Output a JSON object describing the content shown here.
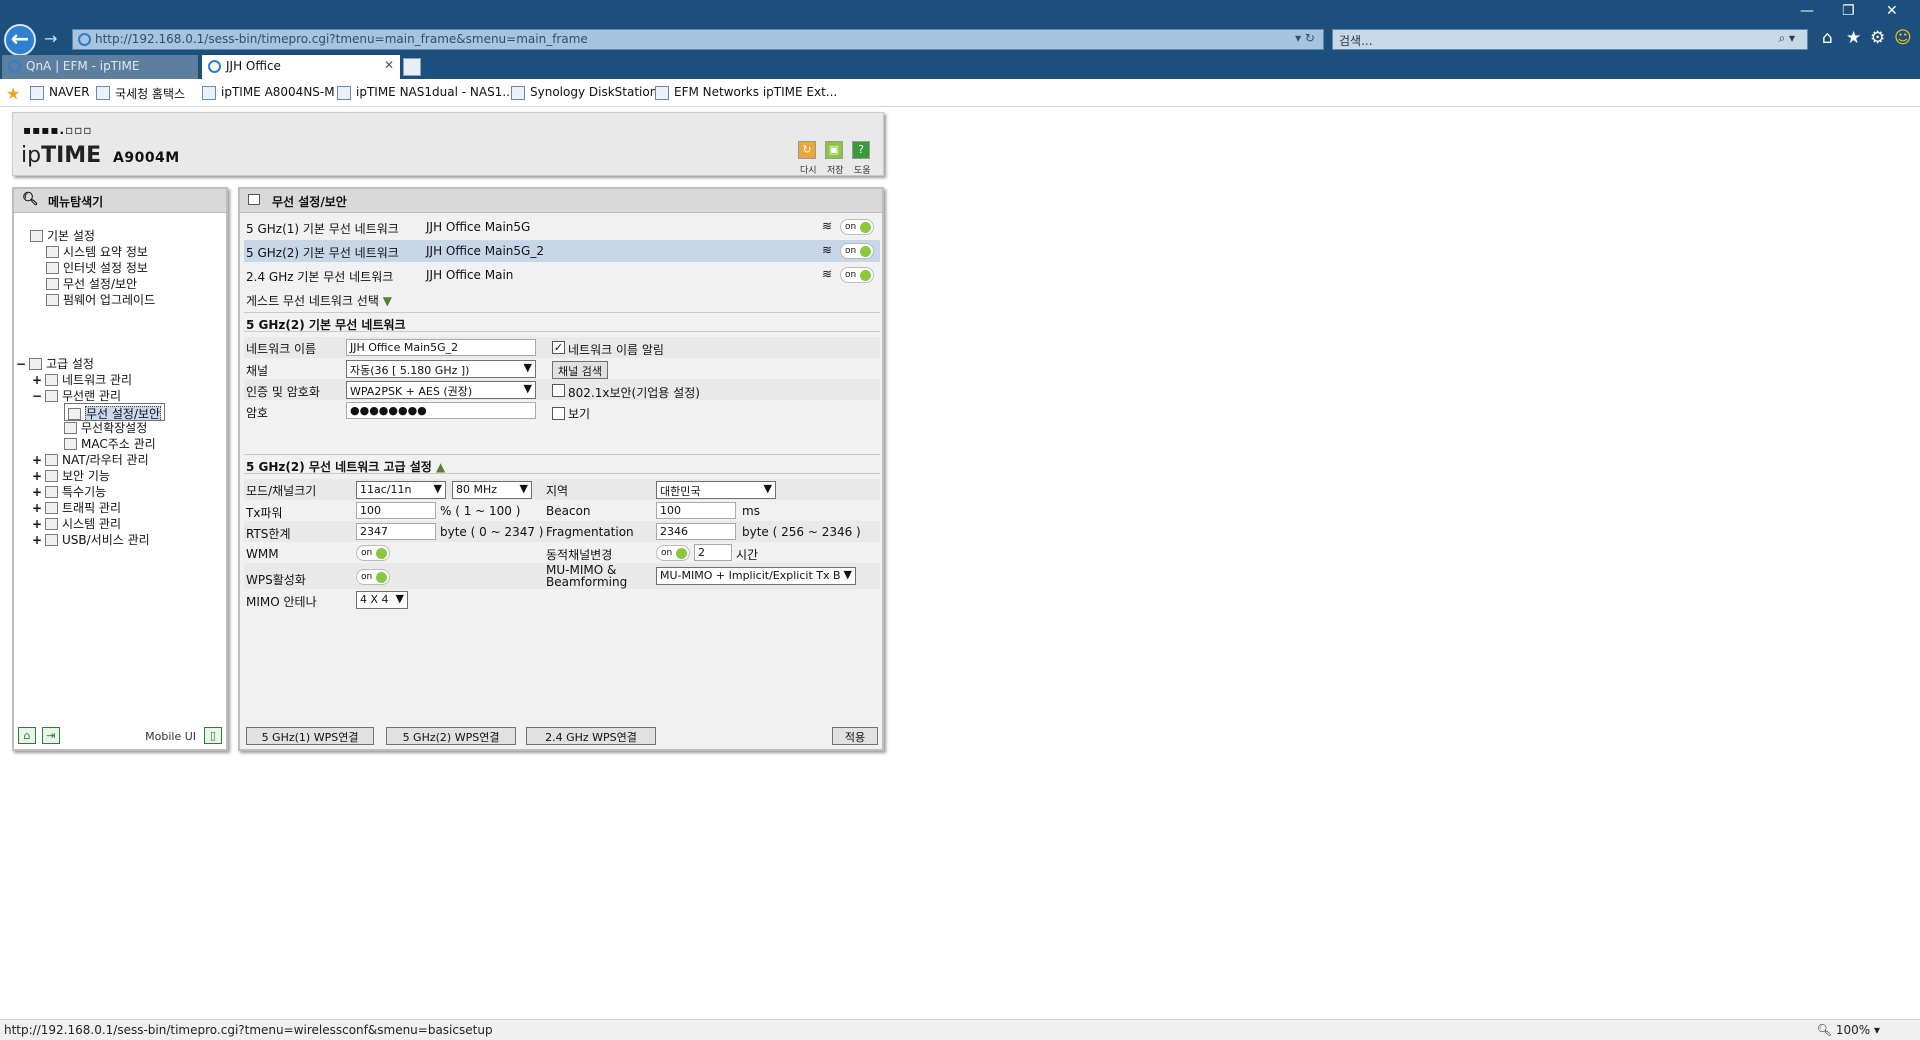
{
  "browser": {
    "url": "http://192.168.0.1/sess-bin/timepro.cgi?tmenu=main_frame&smenu=main_frame",
    "search_placeholder": "검색...",
    "tabs": [
      {
        "label": "QnA | EFM - ipTIME"
      },
      {
        "label": "JJH Office"
      }
    ],
    "favorites": [
      {
        "label": "NAVER"
      },
      {
        "label": "국세청 홈택스"
      },
      {
        "label": "ipTIME A8004NS-M"
      },
      {
        "label": "ipTIME NAS1dual - NAS1..."
      },
      {
        "label": "Synology DiskStation"
      },
      {
        "label": "EFM Networks ipTIME Ext..."
      }
    ],
    "status_url": "http://192.168.0.1/sess-bin/timepro.cgi?tmenu=wirelessconf&smenu=basicsetup",
    "zoom": "100%"
  },
  "router": {
    "brand_prefix": "ip",
    "brand_bold": "TIME",
    "model": "A9004M",
    "header_buttons": [
      {
        "label": "다시"
      },
      {
        "label": "저장"
      },
      {
        "label": "도움"
      }
    ]
  },
  "sidebar": {
    "title": "메뉴탐색기",
    "basic": {
      "label": "기본 설정",
      "items": [
        "시스템 요약 정보",
        "인터넷 설정 정보",
        "무선 설정/보안",
        "펌웨어 업그레이드"
      ]
    },
    "advanced": {
      "label": "고급 설정",
      "items": [
        {
          "label": "네트워크 관리",
          "pm": "+"
        },
        {
          "label": "무선랜 관리",
          "pm": "−"
        },
        {
          "label": "NAT/라우터 관리",
          "pm": "+"
        },
        {
          "label": "보안 기능",
          "pm": "+"
        },
        {
          "label": "특수기능",
          "pm": "+"
        },
        {
          "label": "트래픽 관리",
          "pm": "+"
        },
        {
          "label": "시스템 관리",
          "pm": "+"
        },
        {
          "label": "USB/서비스 관리",
          "pm": "+"
        }
      ],
      "wireless_sub": [
        "무선 설정/보안",
        "무선확장설정",
        "MAC주소 관리"
      ]
    },
    "mobile_ui": "Mobile UI"
  },
  "main": {
    "title": "무선 설정/보안",
    "networks": [
      {
        "name": "5 GHz(1) 기본 무선 네트워크",
        "ssid": "JJH Office Main5G",
        "state": "on"
      },
      {
        "name": "5 GHz(2) 기본 무선 네트워크",
        "ssid": "JJH Office Main5G_2",
        "state": "on"
      },
      {
        "name": "2.4 GHz 기본 무선 네트워크",
        "ssid": "JJH Office Main",
        "state": "on"
      }
    ],
    "guest_label": "게스트 무선 네트워크 선택",
    "basic_section": {
      "title": "5 GHz(2) 기본 무선 네트워크",
      "network_name_label": "네트워크 이름",
      "network_name_value": "JJH Office Main5G_2",
      "broadcast_label": "네트워크 이름 알림",
      "channel_label": "채널",
      "channel_value": "자동(36 [ 5.180 GHz ])",
      "channel_search": "채널 검색",
      "auth_label": "인증 및 암호화",
      "auth_value": "WPA2PSK + AES (권장)",
      "enterprise_label": "802.1x보안(기업용 설정)",
      "password_label": "암호",
      "password_value": "●●●●●●●●",
      "show_label": "보기"
    },
    "advanced_section": {
      "title": "5 GHz(2) 무선 네트워크 고급 설정",
      "mode_label": "모드/채널크기",
      "mode_value": "11ac/11n",
      "width_value": "80 MHz",
      "region_label": "지역",
      "region_value": "대한민국",
      "tx_label": "Tx파워",
      "tx_value": "100",
      "tx_unit": "% ( 1 ~ 100 )",
      "beacon_label": "Beacon",
      "beacon_value": "100",
      "beacon_unit": "ms",
      "rts_label": "RTS한계",
      "rts_value": "2347",
      "rts_unit": "byte ( 0 ~ 2347 )",
      "frag_label": "Fragmentation",
      "frag_value": "2346",
      "frag_unit": "byte ( 256 ~ 2346 )",
      "wmm_label": "WMM",
      "dyn_label": "동적채널변경",
      "dyn_value": "2",
      "dyn_unit": "시간",
      "wps_label": "WPS활성화",
      "mumimo_label1": "MU-MIMO &",
      "mumimo_label2": "Beamforming",
      "mumimo_value": "MU-MIMO + Implicit/Explicit Tx B",
      "mimo_label": "MIMO 안테나",
      "mimo_value": "4 X 4",
      "toggle_text": "on"
    },
    "footer_buttons": {
      "wps1": "5 GHz(1) WPS연결",
      "wps2": "5 GHz(2) WPS연결",
      "wps24": "2.4 GHz WPS연결",
      "apply": "적용"
    }
  }
}
